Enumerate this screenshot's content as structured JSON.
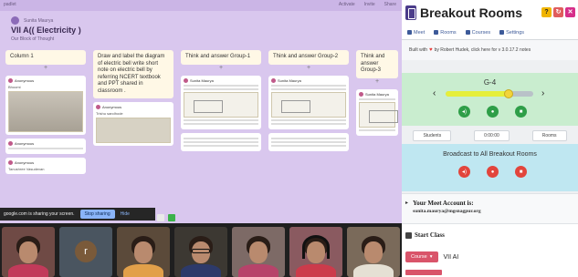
{
  "padlet": {
    "top_left": "padlet",
    "top_right": [
      "Activate",
      "Invite",
      "Share"
    ],
    "author": "Sunita Maurya",
    "title": "VII A(( Electricity )",
    "subtitle": "Our Block of Thought",
    "columns": [
      {
        "header": "Column 1"
      },
      {
        "header": "Draw and label the diagram of electric bell write short note on electric bell by referring NCERT textbook and PPT shared in classroom ."
      },
      {
        "header": "Think and answer Group-1"
      },
      {
        "header": "Think and answer Group-2"
      },
      {
        "header": "Think and answer Group-3"
      }
    ],
    "cards": {
      "c1_a_who": "Anonymous",
      "c1_a_text": "Bhoomi",
      "c1_b_who": "Anonymous",
      "c1_c_who": "Anonymous",
      "c1_c_text": "Tanushree Vasudevan",
      "c2_a_who": "Anonymous",
      "c2_a_text": "Trishu sandhode",
      "c3_who": "Sunita Maurya",
      "c4_who": "Sunita Maurya",
      "c5_who": "Sunita Maurya"
    }
  },
  "sharebar": {
    "text": "google.com is sharing your screen.",
    "stop": "Stop sharing",
    "hide": "Hide"
  },
  "breakout": {
    "title": "Breakout Rooms",
    "title_btns": [
      "?",
      "↻",
      "✕"
    ],
    "tabs": [
      "Meet",
      "Rooms",
      "Courses",
      "Settings"
    ],
    "built_pre": "Built with",
    "built_post": "by Robert Hudek, click here for v 3.0.17.2 notes",
    "room": "G-4",
    "slider_level": 0.72,
    "prev": "‹",
    "next": "›",
    "timers": [
      "Students",
      "0:00:00",
      "Rooms"
    ],
    "broadcast": "Broadcast to All Breakout Rooms",
    "account_title": "Your Meet Account is:",
    "account_email": "sunita.maurya@mgsnagpur.org"
  },
  "class": {
    "title": "Start Class",
    "course_btn": "Course",
    "course_val": "VII AI"
  },
  "videos": [
    {
      "kind": "person",
      "bg": "#6f4a45",
      "body": "#c23a5a"
    },
    {
      "kind": "avatar",
      "letter": "r",
      "bg": "#4a5560"
    },
    {
      "kind": "person",
      "bg": "#5b4a3a",
      "body": "#e2a04a"
    },
    {
      "kind": "glasses",
      "bg": "#3c3832",
      "body": "#2d3a6a"
    },
    {
      "kind": "person",
      "bg": "#7d6a66",
      "body": "#b7436a"
    },
    {
      "kind": "headset",
      "bg": "#8a5a60",
      "body": "#cc3b4b"
    },
    {
      "kind": "person",
      "bg": "#7a6a5a",
      "body": "#e5e0d4"
    }
  ],
  "colors": {
    "padlet_bg": "#d9c7ee",
    "room_bg": "#c9edcf",
    "broadcast_bg": "#bfe7f1",
    "accent_green": "#2e9e48",
    "accent_red": "#e2453c"
  }
}
